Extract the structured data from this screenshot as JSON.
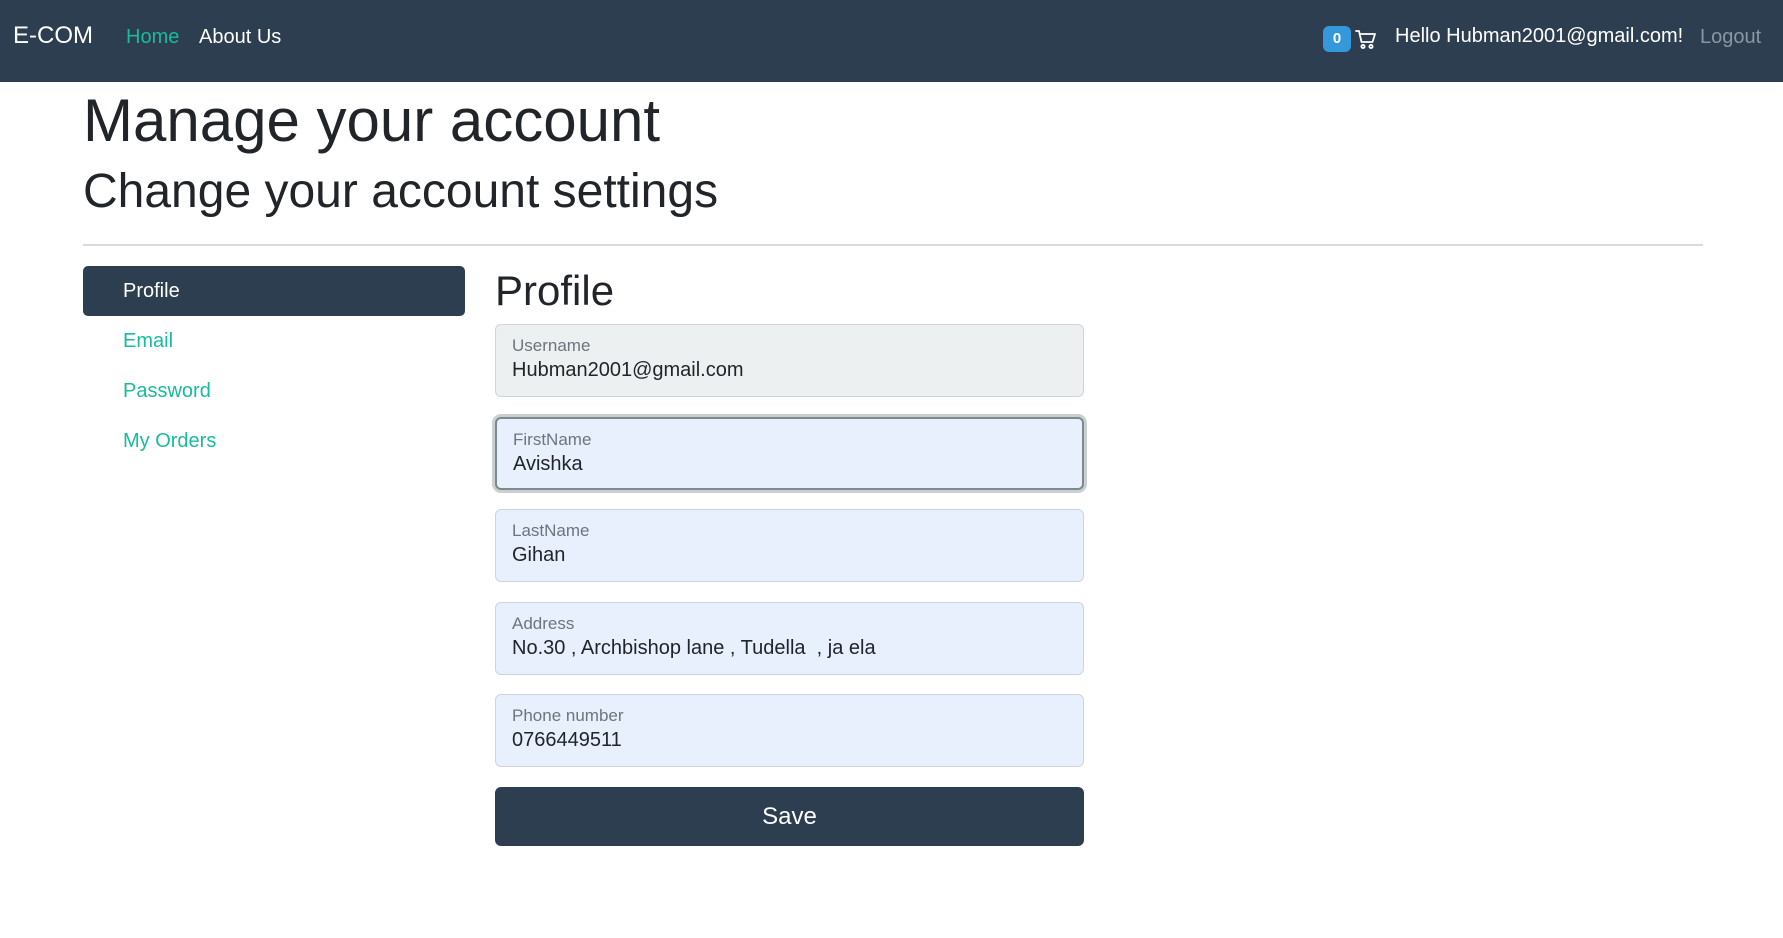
{
  "navbar": {
    "brand": "E-COM",
    "links": [
      {
        "label": "Home"
      },
      {
        "label": "About Us"
      }
    ],
    "cart_count": "0",
    "cart_icon": "cart-icon",
    "greeting": "Hello Hubman2001@gmail.com!",
    "logout_label": "Logout"
  },
  "header": {
    "title": "Manage your account",
    "subtitle": "Change your account settings"
  },
  "sidebar": {
    "items": [
      {
        "label": "Profile",
        "active": true
      },
      {
        "label": "Email"
      },
      {
        "label": "Password"
      },
      {
        "label": "My Orders"
      }
    ]
  },
  "form": {
    "title": "Profile",
    "fields": [
      {
        "label": "Username",
        "value": "Hubman2001@gmail.com",
        "readonly": true
      },
      {
        "label": "FirstName",
        "value": "Avishka",
        "focused": true
      },
      {
        "label": "LastName",
        "value": "Gihan"
      },
      {
        "label": "Address",
        "value": "No.30 , Archbishop lane , Tudella  , ja ela"
      },
      {
        "label": "Phone number",
        "value": "0766449511"
      }
    ],
    "save_label": "Save"
  },
  "colors": {
    "navbar_bg": "#2c3e50",
    "accent": "#18bc9c",
    "badge": "#3498db",
    "input_bg": "#e8f0fe"
  }
}
